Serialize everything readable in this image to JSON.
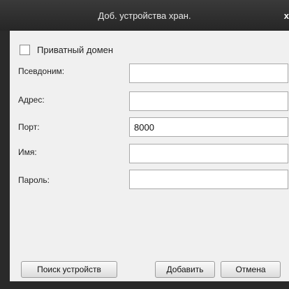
{
  "dialog": {
    "title": "Доб. устройства хран.",
    "close_label": "x"
  },
  "form": {
    "private_domain": {
      "label": "Приватный домен",
      "checked": false
    },
    "fields": [
      {
        "label": "Псевдоним:",
        "value": ""
      },
      {
        "label": "Адрес:",
        "value": ""
      },
      {
        "label": "Порт:",
        "value": "8000"
      },
      {
        "label": "Имя:",
        "value": ""
      },
      {
        "label": "Пароль:",
        "value": ""
      }
    ]
  },
  "buttons": {
    "search_devices": "Поиск устройств",
    "add": "Добавить",
    "cancel": "Отмена"
  }
}
